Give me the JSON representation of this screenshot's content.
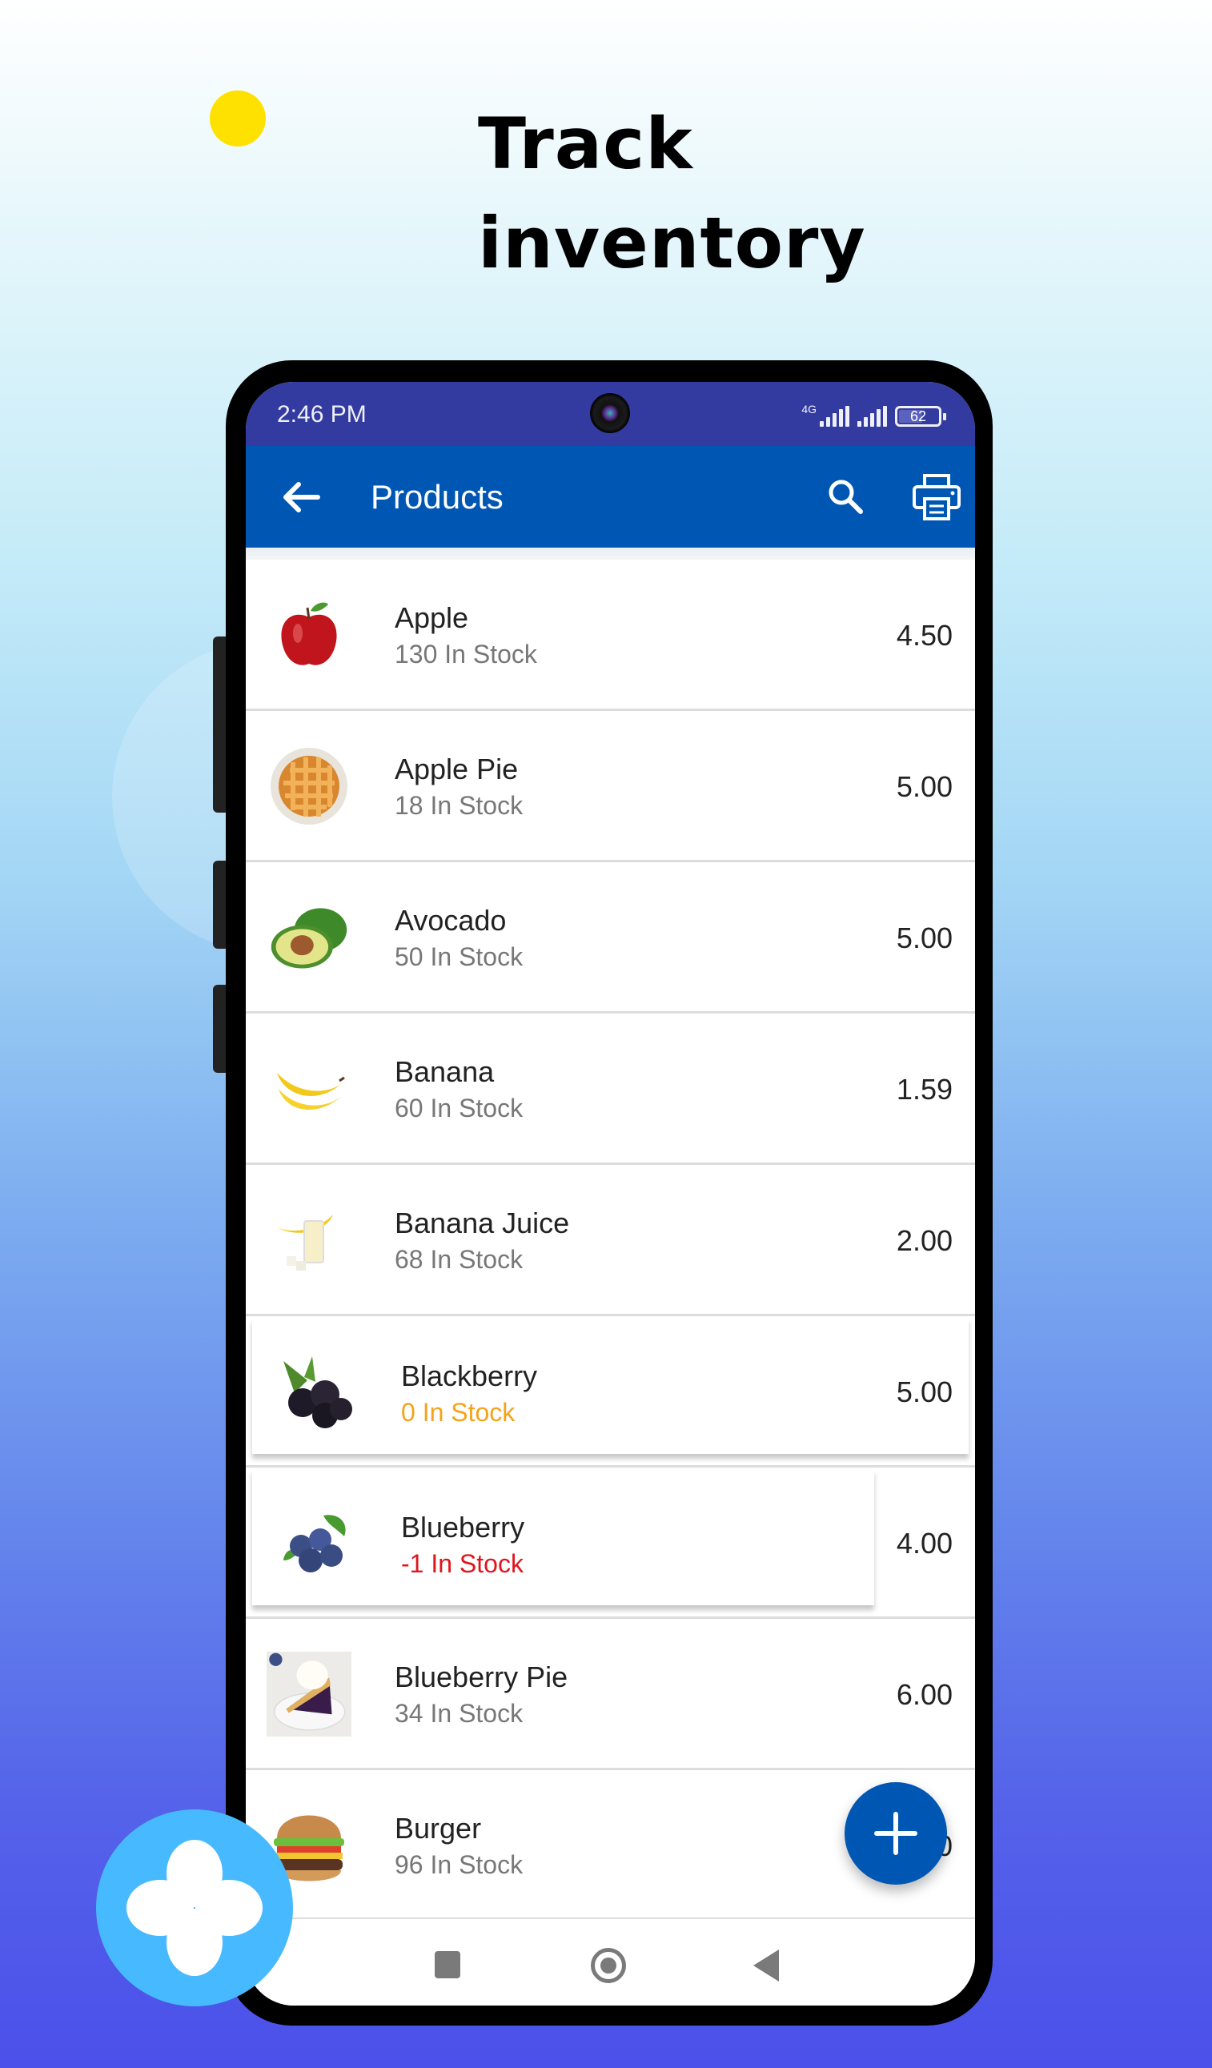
{
  "headline": {
    "line1": "Track",
    "line2": "inventory",
    "dot_color": "#ffe100"
  },
  "status_bar": {
    "time": "2:46 PM",
    "network_label": "4G",
    "battery_percent": 62,
    "battery_label": "62",
    "icons": [
      "signal-icon",
      "signal-icon",
      "battery-icon"
    ]
  },
  "app_bar": {
    "title": "Products",
    "back_icon": "arrow-left-icon",
    "search_icon": "search-icon",
    "print_icon": "printer-icon",
    "color": "#0057b3"
  },
  "products": [
    {
      "name": "Apple",
      "stock": "130 In Stock",
      "price": "4.50",
      "thumb": "apple",
      "stock_state": "normal"
    },
    {
      "name": "Apple Pie",
      "stock": "18 In Stock",
      "price": "5.00",
      "thumb": "apple-pie",
      "stock_state": "normal"
    },
    {
      "name": "Avocado",
      "stock": "50 In Stock",
      "price": "5.00",
      "thumb": "avocado",
      "stock_state": "normal"
    },
    {
      "name": "Banana",
      "stock": "60 In Stock",
      "price": "1.59",
      "thumb": "banana",
      "stock_state": "normal"
    },
    {
      "name": "Banana Juice",
      "stock": "68 In Stock",
      "price": "2.00",
      "thumb": "banana-juice",
      "stock_state": "normal"
    },
    {
      "name": "Blackberry",
      "stock": "0 In Stock",
      "price": "5.00",
      "thumb": "blackberry",
      "stock_state": "zero"
    },
    {
      "name": "Blueberry",
      "stock": "-1 In Stock",
      "price": "4.00",
      "thumb": "blueberry",
      "stock_state": "negative"
    },
    {
      "name": "Blueberry Pie",
      "stock": "34 In Stock",
      "price": "6.00",
      "thumb": "blueberry-pie",
      "stock_state": "normal"
    },
    {
      "name": "Burger",
      "stock": "96 In Stock",
      "price": "0",
      "thumb": "burger",
      "stock_state": "normal"
    }
  ],
  "stock_colors": {
    "normal": "#777777",
    "zero": "#f5a31a",
    "negative": "#e0161e"
  },
  "fab": {
    "icon": "plus-icon",
    "color": "#0057b3"
  },
  "nav_bar": {
    "icons": [
      "recents-square-icon",
      "home-circle-icon",
      "back-triangle-icon"
    ]
  },
  "brand_logo": {
    "icon": "four-petal-logo-icon",
    "color": "#47b9ff"
  }
}
